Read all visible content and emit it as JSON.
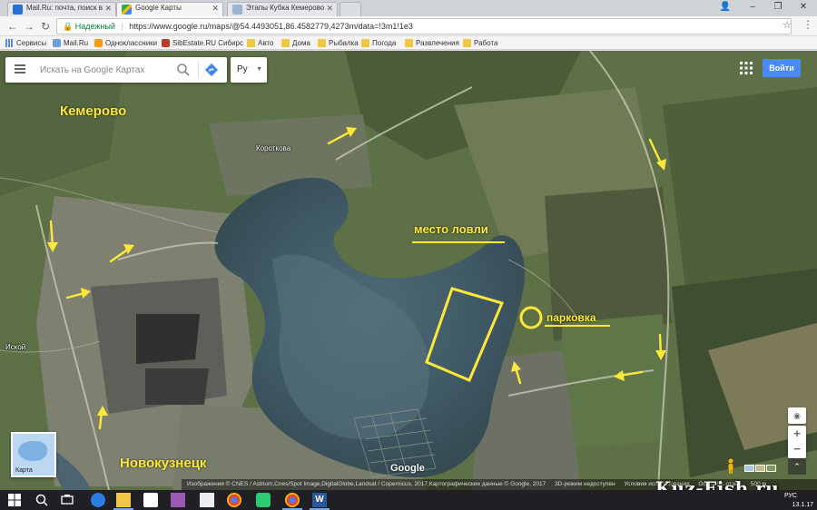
{
  "browser": {
    "tabs": [
      {
        "label": "Mail.Ru: почта, поиск в",
        "icon": "mailru-icon",
        "active": false
      },
      {
        "label": "Google Карты",
        "icon": "google-maps-icon",
        "active": true
      },
      {
        "label": "Этапы Кубка Кемерово",
        "icon": "page-icon",
        "active": false
      }
    ],
    "address": {
      "secure_label": "Надежный",
      "url": "https://www.google.ru/maps/@54.4493051,86.4582779,4273m/data=!3m1!1e3"
    },
    "bookmarks": [
      {
        "label": "Сервисы",
        "icon": "apps"
      },
      {
        "label": "Mail.Ru",
        "icon": "site"
      },
      {
        "label": "Одноклассники",
        "icon": "ok"
      },
      {
        "label": "SibEstate.RU Сибирс",
        "icon": "se"
      },
      {
        "label": "Авто",
        "icon": "folder"
      },
      {
        "label": "Дома",
        "icon": "folder"
      },
      {
        "label": "Рыбалка",
        "icon": "folder"
      },
      {
        "label": "Погода",
        "icon": "folder"
      },
      {
        "label": "Развлечения",
        "icon": "folder"
      },
      {
        "label": "Работа",
        "icon": "folder"
      }
    ]
  },
  "maps": {
    "search_placeholder": "Искать на Google Картах",
    "language": "Ру",
    "signin_label": "Войти",
    "minimap_label": "Карта",
    "google_logo": "Google",
    "attribution": [
      "Изображения © CNES / Astrium,Cnes/Spot Image,DigitalGlobe,Landsat / Copernicus, 2017,Картографические данные © Google, 2017",
      "3D-режим недоступен",
      "Условия использования",
      "Оставить отзыв",
      "500 м"
    ],
    "place_labels": {
      "korotkovo": "Короткова",
      "iskoy": "Иской"
    },
    "annotations": {
      "kemerovo": "Кемерово",
      "novokuznetsk": "Новокузнецк",
      "fishing_spot": "место ловли",
      "parking": "парковка"
    },
    "colors": {
      "annotation": "#ffe838",
      "water": "#3f5866",
      "field": "#5d7046"
    }
  },
  "watermark": "Kuz-Fish.ru",
  "taskbar": {
    "language": "РУС",
    "date": "13.1.17"
  }
}
